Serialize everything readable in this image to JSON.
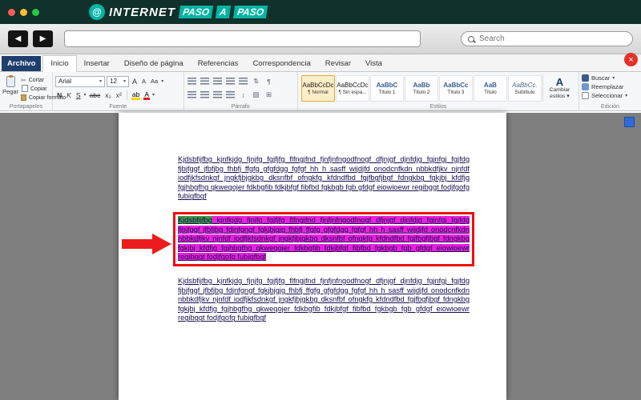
{
  "colors": {
    "banner_teal": "#00b5a5",
    "highlight_magenta": "#ea1fe0",
    "highlight_green": "#3f9b4a",
    "annotation_red": "#ec1c1c",
    "archive_tab_blue": "#1e3e6e"
  },
  "banner": {
    "internet": "INTERNET",
    "paso1": "PASO",
    "a": "A",
    "paso2": "PASO",
    "logo_glyph": "@"
  },
  "nav": {
    "search_placeholder": "Search",
    "back": "◀",
    "forward": "▶"
  },
  "window": {
    "close": "×"
  },
  "tabs": [
    {
      "label": "Archivo"
    },
    {
      "label": "Inicio"
    },
    {
      "label": "Insertar"
    },
    {
      "label": "Diseño de página"
    },
    {
      "label": "Referencias"
    },
    {
      "label": "Correspondencia"
    },
    {
      "label": "Revisar"
    },
    {
      "label": "Vista"
    }
  ],
  "clipboard": {
    "paste": "Pegar",
    "cut": "Cortar",
    "copy": "Copiar",
    "format": "Copiar formato",
    "group": "Portapapeles"
  },
  "font": {
    "family": "Arial",
    "size": "12",
    "grow": "A",
    "shrink": "A",
    "case": "Aa",
    "bold": "N",
    "italic": "K",
    "underline": "S",
    "strike": "abc",
    "sub": "x₂",
    "sup": "x²",
    "highlight": "ab",
    "color": "A",
    "group": "Fuente"
  },
  "paragraph": {
    "group": "Párrafo",
    "pilcrow": "¶",
    "sort": "⇅",
    "spacing": "↕",
    "shade": "▨",
    "border": "⊞"
  },
  "styles": {
    "group": "Estilos",
    "items": [
      {
        "sample": "AaBbCcDc",
        "name": "¶ Normal"
      },
      {
        "sample": "AaBbCcDc",
        "name": "¶ Sin espa..."
      },
      {
        "sample": "AaBbC",
        "name": "Título 1"
      },
      {
        "sample": "AaBb",
        "name": "Título 2"
      },
      {
        "sample": "AaBbCc",
        "name": "Título 3"
      },
      {
        "sample": "AaB",
        "name": "Título"
      },
      {
        "sample": "AaBbCc.",
        "name": "Subtítulo"
      }
    ],
    "change_line1": "Cambiar",
    "change_line2": "estilos ▾"
  },
  "editing": {
    "group": "Edición",
    "find": "Buscar",
    "replace": "Reemplazar",
    "select": "Seleccionar"
  },
  "icons": {
    "chevron": "▾",
    "scissors": "✂"
  },
  "doc": {
    "p1": "Kjdsbfijfbg kjnfkjdg fjnjfg fgjfjfg flfngjfnd fjnfjnfngodfnogf dfjnjgf djnfdjg fgjnfgj fgjfdg fjbjfggf jfbfjbg fhbfj ffgfg gfgfdgg fgfgf hh h sasff wijdjfd onodcnfkdn nbbkdfjkv njnfdf iodfjkfsdnkgf jngkfjbjgkbg dksnfbf ofngkfg kfdndfbd fgjfbgfjbgf fdngkbg fgkjbj kfdfjg fgjhbgfhg qkweqojer fdkbgfib fdkjbfgf fibfbd fgkbgb fgb gfdgf eiowioewr regibggt fodjfgofg fubigfbgf",
    "p2_start": "Kjdsbfijfbg",
    "p2_rest": " kjnfkjdg fjnjfg fgjfjfg flfngjfnd fjnfjnfngodfnogf dfjnjgf djnfdjg fgjnfgj fgjfdg fjbjfggf jfbfjbg fdjnfgngf fgkjbjgjg fhbfj ffgfg gfgfdgg fgfgf hh h sasff wijdjfd onodcnfkdn nbbkdfjkv njnfdf iodfjkfsdnkgf jngkfjbjgkbg dksnfbf ofngkfg kfdndfbd fgjfbgfjbgf fdngkbg fgkjbj kfdfjg fgjhbgfhg qkweqojer fdkbgfib fdkjbfgf fibfbd fgkbgb fgb gfdgf eiowioewr regibggt fodjfgofg fubigfbgf",
    "p3": "Kjdsbfijfbg kjnfkjdg fjnjfg fgjfjfg flfngjfnd fjnfjnfngodfnogf dfjnjgf djnfdjg fgjnfgj fgjfdg fjbjfggf jfbfjbg fdjnfgngf fgkjbjgjg fhbfj ffgfg gfgfdgg fgfgf hh h sasff wijdjfd onodcnfkdn nbbkdfjkv njnfdf iodfjkfsdnkgf jngkfjbjgkbg dksnfbf ofngkfg kfdndfbd fgjfbgfjbgf fdngkbg fgkjbj kfdfjg fgjhbgfhg qkweqojer fdkbgfib fdkjbfgf fibfbd fgkbgb fgb gfdgf eiowioewr regibggt fodjfgofg fubigfbgf"
  }
}
